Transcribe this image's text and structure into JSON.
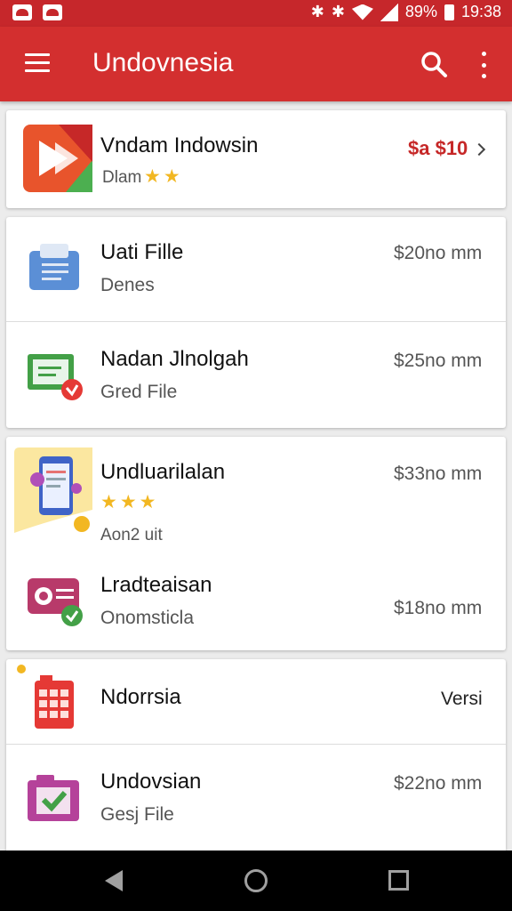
{
  "status_bar": {
    "battery": "89%",
    "time": "19:38"
  },
  "app_bar": {
    "title": "Undovnesia"
  },
  "items": [
    {
      "title": "Vndam Indowsin",
      "subtitle": "Dlam",
      "rating": "★★",
      "price": "$a $10"
    },
    {
      "title": "Uati Fille",
      "subtitle": "Denes",
      "price": "$20no mm"
    },
    {
      "title": "Nadan Jlnolgah",
      "subtitle": "Gred File",
      "price": "$25no mm"
    },
    {
      "title": "Undluarilalan",
      "rating": "★★★",
      "subtitle": "Aon2 uit",
      "price": "$33no mm"
    },
    {
      "title": "Lradteaisan",
      "subtitle": "Onomsticla",
      "price": "$18no mm"
    },
    {
      "title": "Ndorrsia",
      "price": "Versi"
    },
    {
      "title": "Undovsian",
      "subtitle": "Gesj File",
      "price": "$22no mm"
    }
  ],
  "colors": {
    "app_bar": "#d32f2f",
    "status_bar": "#c6272b",
    "star": "#f2b722",
    "price_highlight": "#c62828"
  }
}
